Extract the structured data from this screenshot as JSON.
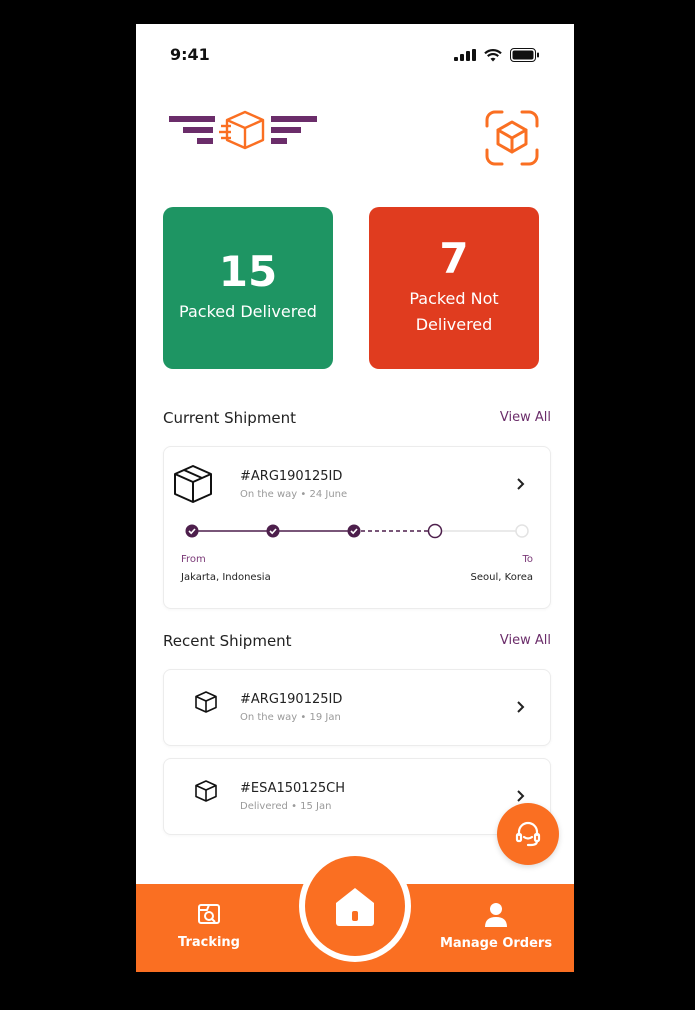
{
  "status_bar": {
    "time": "9:41"
  },
  "stats": {
    "delivered": {
      "count": "15",
      "label": "Packed Delivered",
      "color": "#1e9563"
    },
    "not_delivered": {
      "count": "7",
      "label": "Packed Not Delivered",
      "color": "#e03c1f"
    }
  },
  "current": {
    "title": "Current Shipment",
    "view_all": "View All",
    "shipment": {
      "id": "#ARG190125ID",
      "status": "On the way",
      "date": "24 June",
      "from_label": "From",
      "from_place": "Jakarta, Indonesia",
      "to_label": "To",
      "to_place": "Seoul, Korea",
      "completed_steps": 3,
      "total_steps": 5
    }
  },
  "recent": {
    "title": "Recent Shipment",
    "view_all": "View All",
    "items": [
      {
        "id": "#ARG190125ID",
        "status": "On the way",
        "date": "19 Jan"
      },
      {
        "id": "#ESA150125CH",
        "status": "Delivered",
        "date": "15 Jan"
      }
    ]
  },
  "nav": {
    "tracking": "Tracking",
    "manage_orders": "Manage Orders"
  },
  "colors": {
    "brand_purple": "#6b2d6a",
    "accent_orange": "#fa6f22"
  },
  "icons": [
    "signal-icon",
    "wifi-icon",
    "battery-icon",
    "logo-icon",
    "scan-box-icon",
    "box-icon",
    "chevron-right-icon",
    "home-icon",
    "tracking-icon",
    "user-icon",
    "headset-icon"
  ]
}
